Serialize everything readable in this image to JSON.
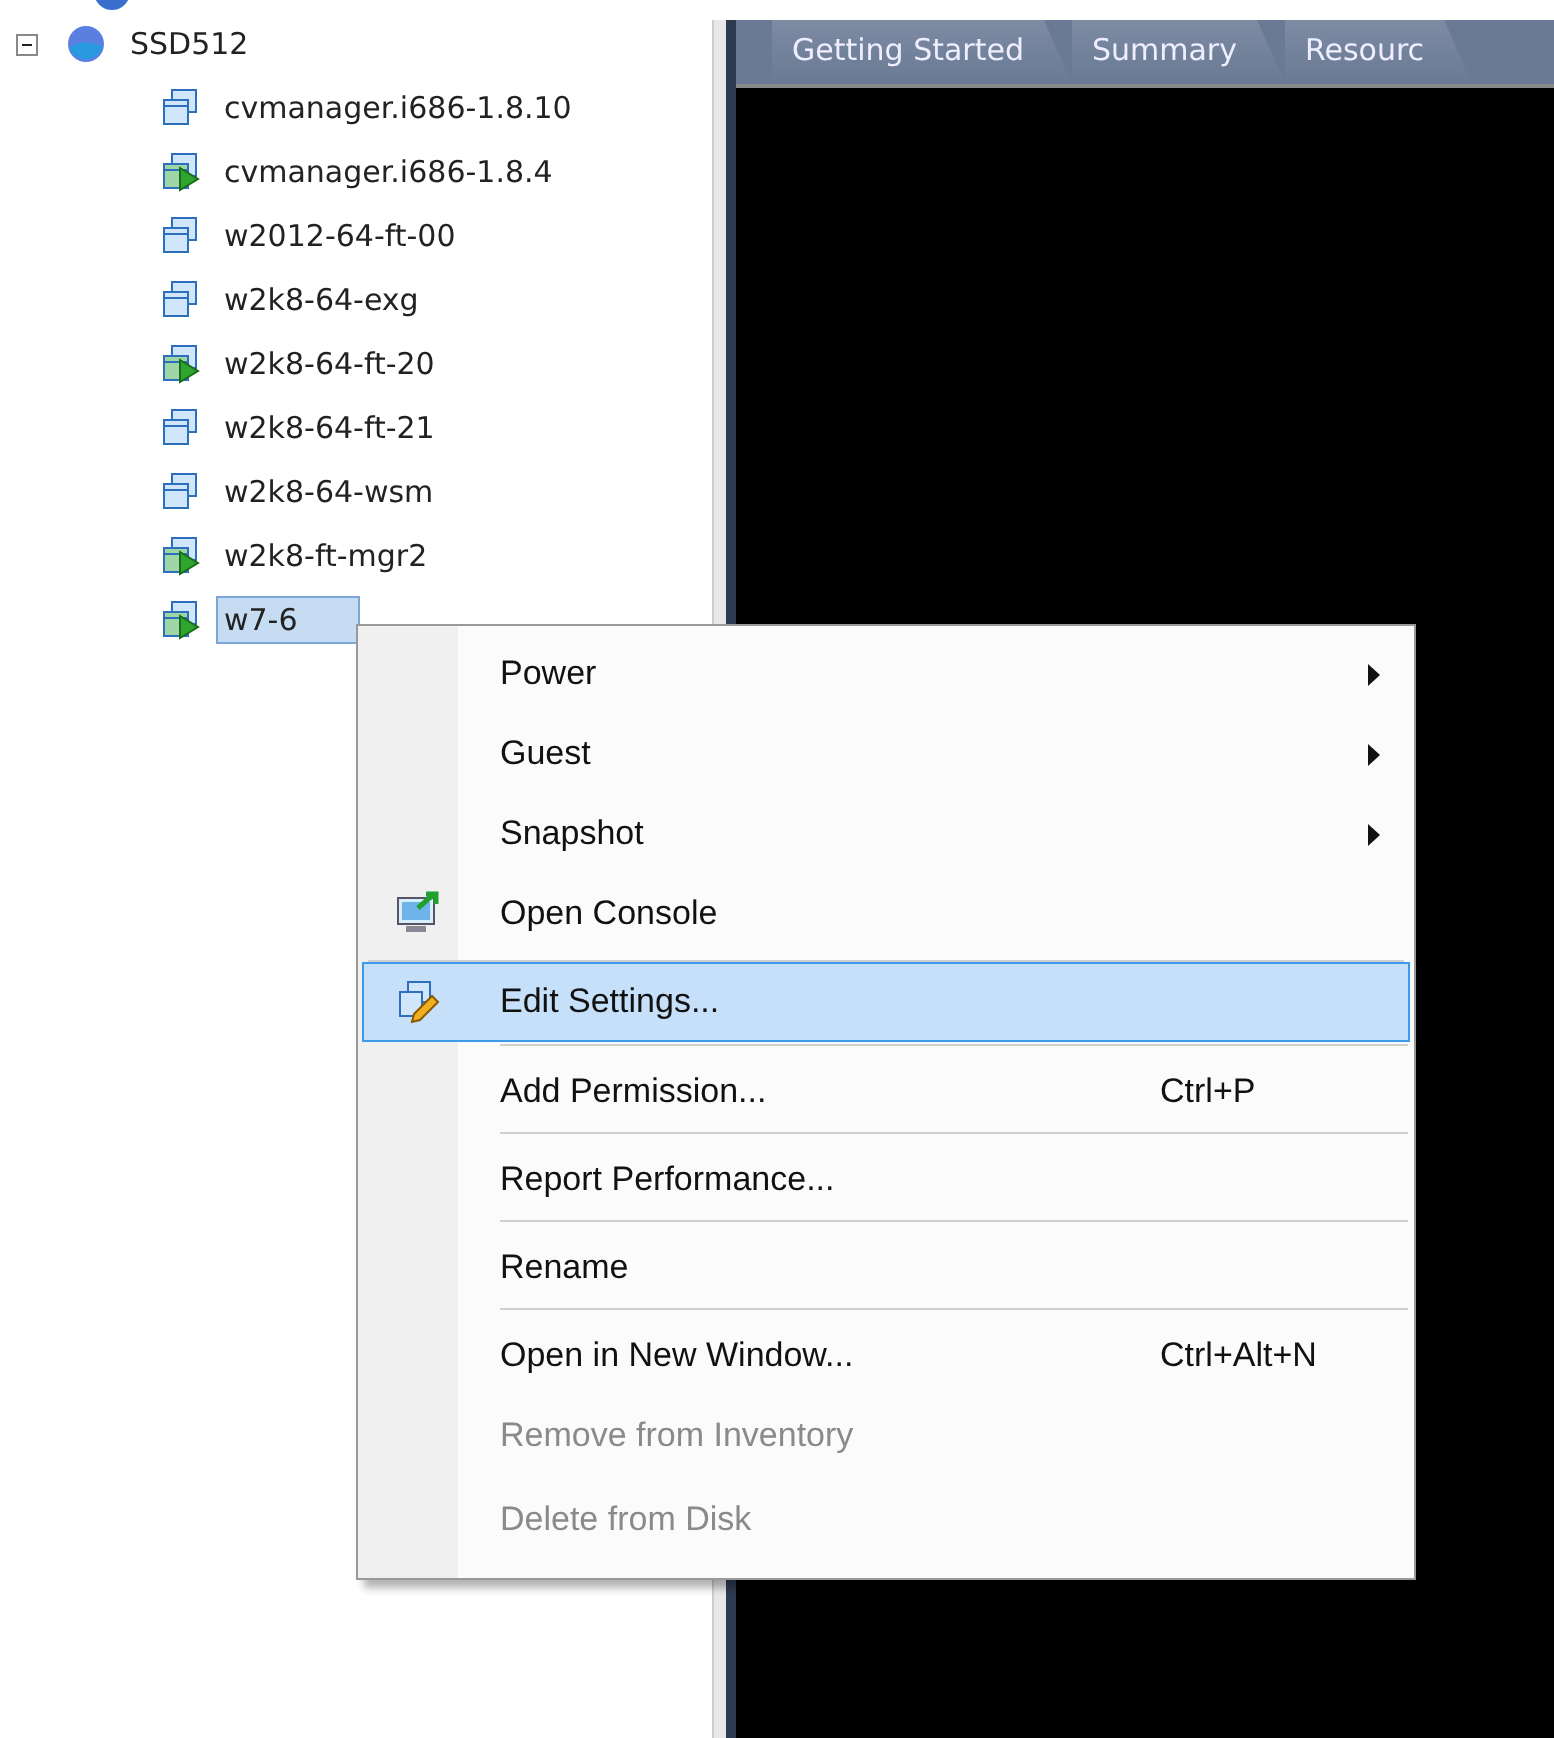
{
  "tree": {
    "items": [
      {
        "label": "SSD512",
        "kind": "datastore",
        "expanded": true,
        "selected": false,
        "children": [
          {
            "label": "cvmanager.i686-1.8.10",
            "kind": "vm",
            "powered_on": false,
            "selected": false
          },
          {
            "label": "cvmanager.i686-1.8.4",
            "kind": "vm",
            "powered_on": true,
            "selected": false
          },
          {
            "label": "w2012-64-ft-00",
            "kind": "vm",
            "powered_on": false,
            "selected": false
          },
          {
            "label": "w2k8-64-exg",
            "kind": "vm",
            "powered_on": false,
            "selected": false
          },
          {
            "label": "w2k8-64-ft-20",
            "kind": "vm",
            "powered_on": true,
            "selected": false
          },
          {
            "label": "w2k8-64-ft-21",
            "kind": "vm",
            "powered_on": false,
            "selected": false
          },
          {
            "label": "w2k8-64-wsm",
            "kind": "vm",
            "powered_on": false,
            "selected": false
          },
          {
            "label": "w2k8-ft-mgr2",
            "kind": "vm",
            "powered_on": true,
            "selected": false
          },
          {
            "label": "w7-6",
            "kind": "vm",
            "powered_on": true,
            "selected": true
          }
        ]
      }
    ]
  },
  "tabs": [
    {
      "label": "Getting Started",
      "selected": false
    },
    {
      "label": "Summary",
      "selected": false
    },
    {
      "label": "Resourc",
      "selected": false
    }
  ],
  "context_menu": {
    "items": [
      {
        "label": "Power",
        "kind": "plain",
        "submenu": true,
        "selected": false,
        "disabled": false,
        "separator_before": false
      },
      {
        "label": "Guest",
        "kind": "plain",
        "submenu": true,
        "selected": false,
        "disabled": false,
        "separator_before": false
      },
      {
        "label": "Snapshot",
        "kind": "plain",
        "submenu": true,
        "selected": false,
        "disabled": false,
        "separator_before": false
      },
      {
        "label": "Open Console",
        "kind": "console",
        "submenu": false,
        "selected": false,
        "disabled": false,
        "separator_before": false
      },
      {
        "label": "Edit Settings...",
        "kind": "edit",
        "submenu": false,
        "selected": true,
        "disabled": false,
        "separator_before": true
      },
      {
        "label": "Add Permission...",
        "kind": "plain",
        "shortcut": "Ctrl+P",
        "submenu": false,
        "selected": false,
        "disabled": false,
        "separator_before": true
      },
      {
        "label": "Report Performance...",
        "kind": "plain",
        "submenu": false,
        "selected": false,
        "disabled": false,
        "separator_before": true
      },
      {
        "label": "Rename",
        "kind": "plain",
        "submenu": false,
        "selected": false,
        "disabled": false,
        "separator_before": true
      },
      {
        "label": "Open in New Window...",
        "kind": "plain",
        "shortcut": "Ctrl+Alt+N",
        "submenu": false,
        "selected": false,
        "disabled": false,
        "separator_before": true
      },
      {
        "label": "Remove from Inventory",
        "kind": "plain",
        "submenu": false,
        "selected": false,
        "disabled": true,
        "separator_before": false
      },
      {
        "label": "Delete from Disk",
        "kind": "plain",
        "submenu": false,
        "selected": false,
        "disabled": true,
        "separator_before": false
      }
    ]
  }
}
